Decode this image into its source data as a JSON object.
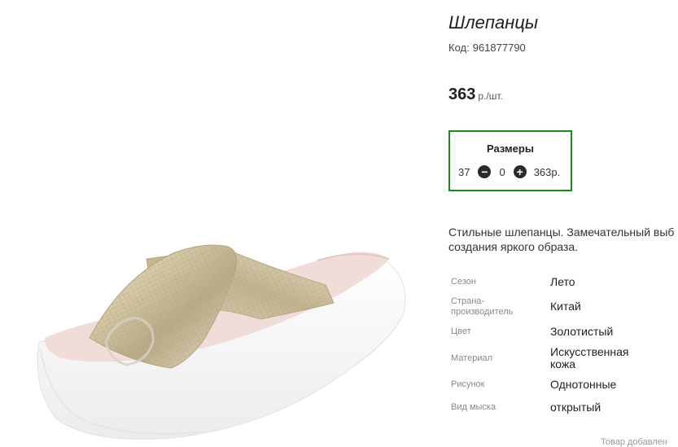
{
  "product": {
    "title": "Шлепанцы",
    "code_label": "Код:",
    "code_value": "961877790",
    "price_value": "363",
    "price_unit": "р./шт."
  },
  "sizes": {
    "title": "Размеры",
    "rows": [
      {
        "size": "37",
        "minus_icon": "minus-circle-icon",
        "quantity": "0",
        "plus_icon": "plus-circle-icon",
        "price": "363р."
      }
    ]
  },
  "description": {
    "line1": "Стильные шлепанцы. Замечательный выб",
    "line2": "создания яркого образа."
  },
  "properties": [
    {
      "name": "Сезон",
      "value": "Лето"
    },
    {
      "name": "Страна-\nпроизводитель",
      "value": "Китай"
    },
    {
      "name": "Цвет",
      "value": "Золотистый"
    },
    {
      "name": "Материал",
      "value": "Искусственная\nкожа"
    },
    {
      "name": "Рисунок",
      "value": "Однотонные"
    },
    {
      "name": "Вид мыска",
      "value": "открытый"
    }
  ],
  "footer_link": "Товар добавлен",
  "colors": {
    "sizes_border": "#1e8a1e",
    "sole": "#f7f7f7",
    "strap_gold": "#cfc3a2",
    "insole_pink": "#f0dcd8"
  }
}
